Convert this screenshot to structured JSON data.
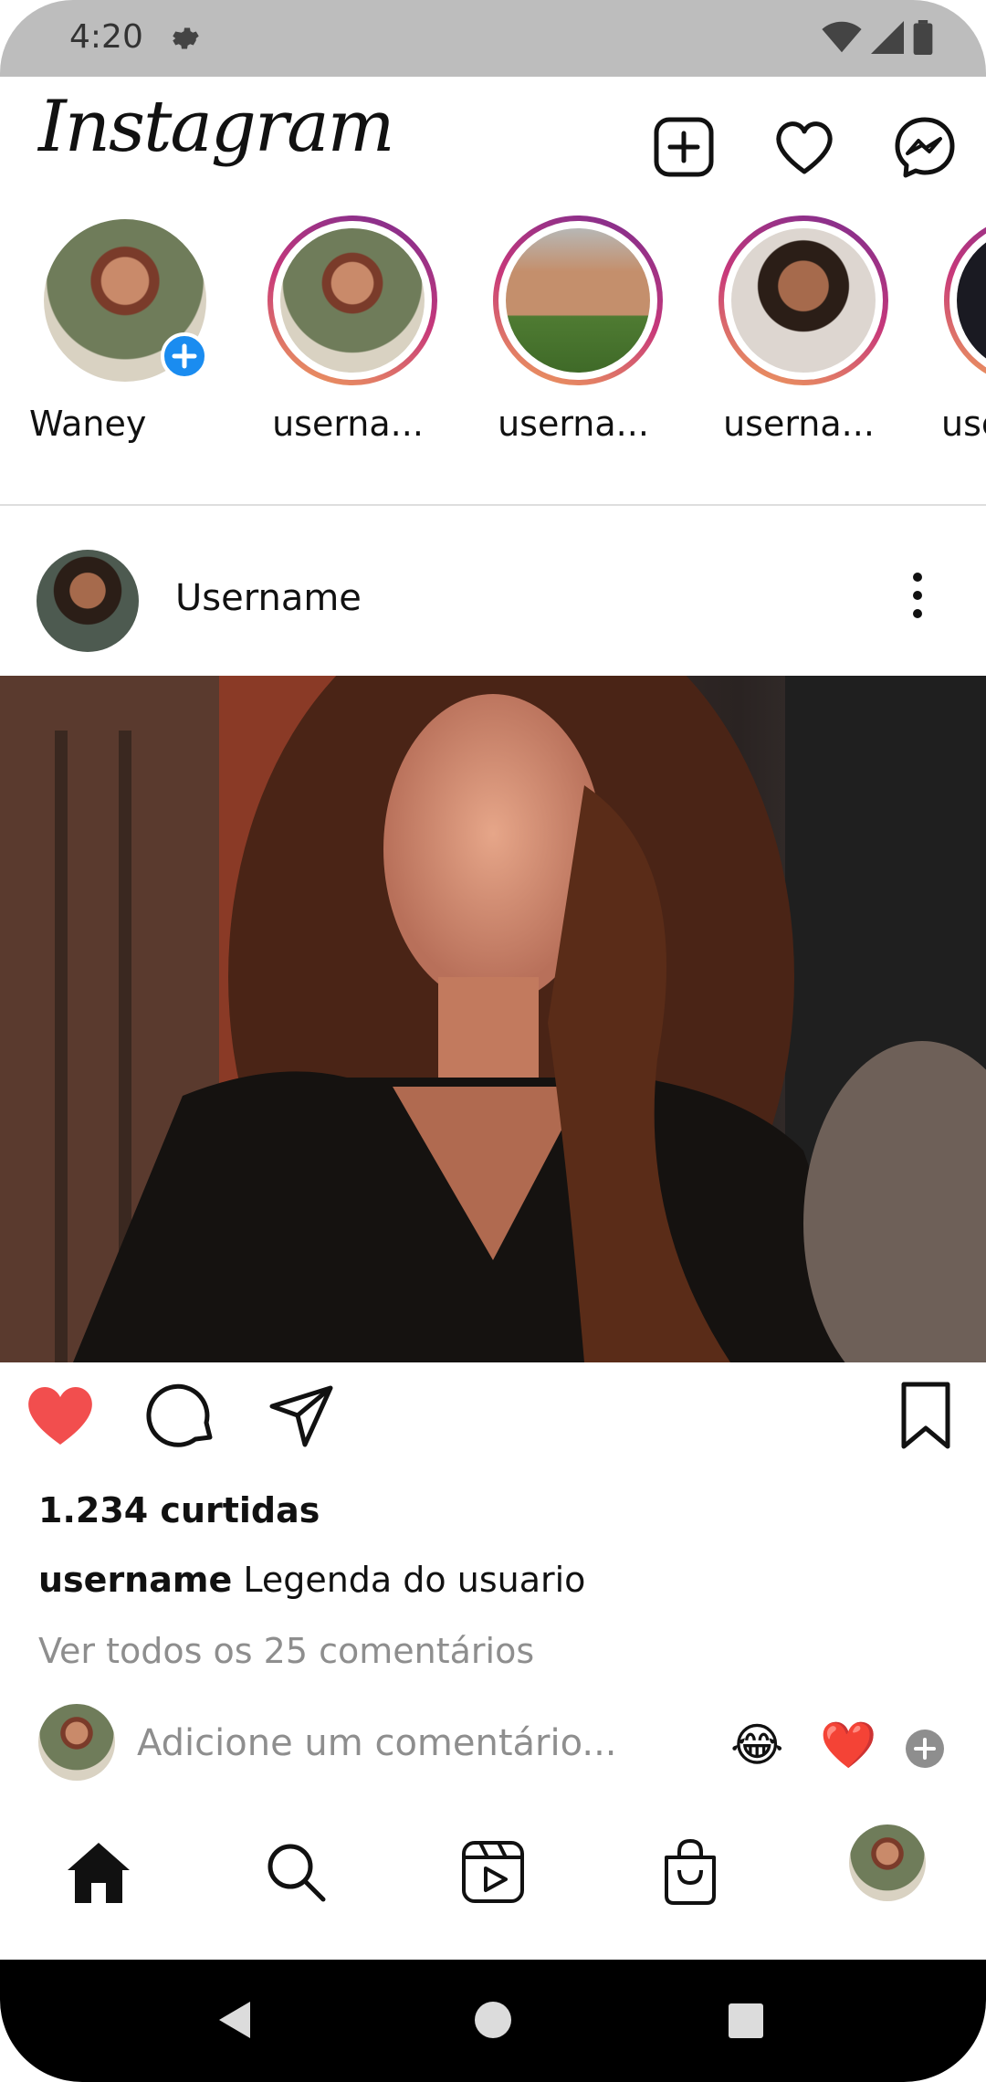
{
  "status_bar": {
    "time": "4:20"
  },
  "header": {
    "logo": "Instagram"
  },
  "stories": [
    {
      "label": "Waney",
      "own": true
    },
    {
      "label": "userna..."
    },
    {
      "label": "userna..."
    },
    {
      "label": "userna..."
    },
    {
      "label": "use"
    }
  ],
  "post": {
    "username": "Username",
    "likes": "1.234 curtidas",
    "caption_user": "username",
    "caption_text": "Legenda do usuario",
    "view_comments": "Ver todos os 25 comentários",
    "comment_placeholder": "Adicione um comentário...",
    "quick_emojis": [
      "😂",
      "❤️"
    ]
  },
  "colors": {
    "like_active": "#f24e4e",
    "story_add_badge": "#1a8cf0"
  }
}
